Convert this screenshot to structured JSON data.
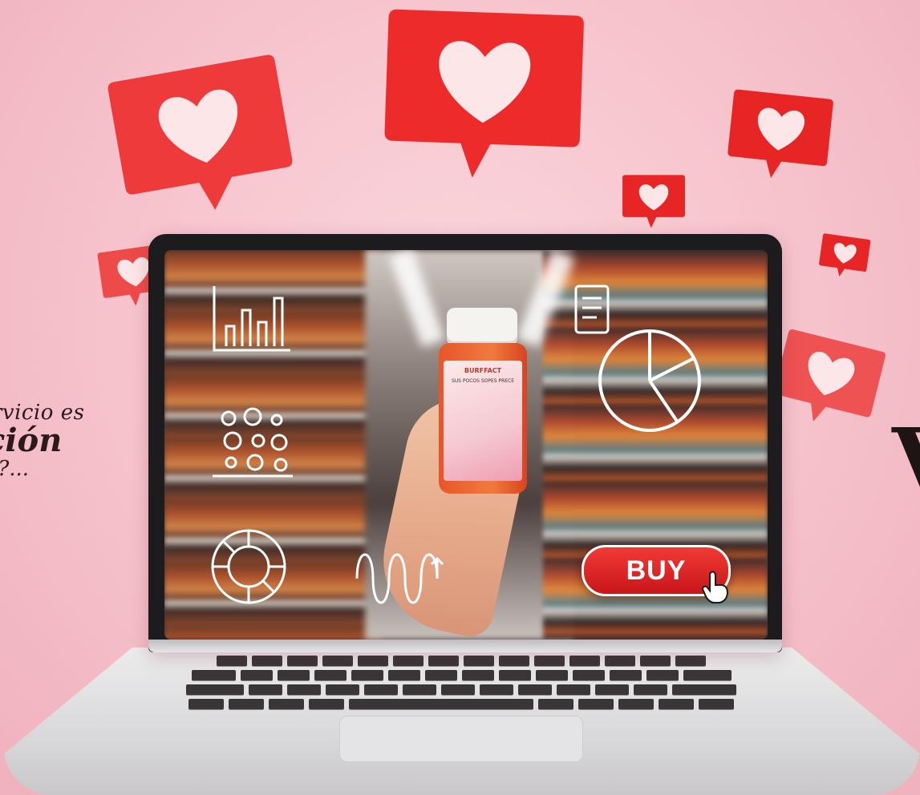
{
  "side_text": {
    "line1": "rvicio es",
    "line2": "ción",
    "line3": "s?..."
  },
  "right_text": "V",
  "screen": {
    "buy_button_label": "BUY",
    "bottle": {
      "title": "BURFFACT",
      "subtitle": "SUS POCOS\nSOPES PRECE"
    }
  },
  "colors": {
    "background": "#f6c2cb",
    "heart_bubble": "#ee2b2b",
    "buy_button": "#d81d1f",
    "laptop_bezel": "#1c1c1e"
  },
  "icons": [
    "heart-bubble-icon",
    "bar-chart-icon",
    "bubble-chart-icon",
    "donut-chart-icon",
    "wave-chart-icon",
    "document-icon",
    "pie-chart-icon",
    "pointer-hand-icon"
  ]
}
